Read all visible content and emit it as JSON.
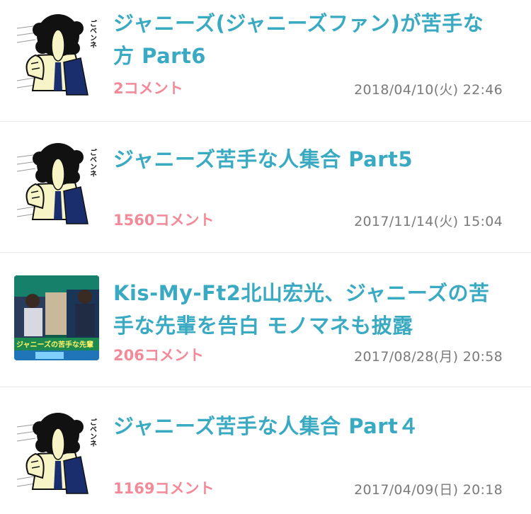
{
  "articles": [
    {
      "title": "ジャニーズ(ジャニーズファン)が苦手な方 Part6",
      "comments": "2コメント",
      "date": "2018/04/10(火) 22:46",
      "thumb_text": "ごベンネ"
    },
    {
      "title": "ジャニーズ苦手な人集合 Part5",
      "comments": "1560コメント",
      "date": "2017/11/14(火) 15:04",
      "thumb_text": "ごベンネ"
    },
    {
      "title": "Kis-My-Ft2北山宏光、ジャニーズの苦手な先輩を告白 モノマネも披露",
      "comments": "206コメント",
      "date": "2017/08/28(月) 20:58",
      "thumb_text": "ジャニーズの苦手な先輩"
    },
    {
      "title": "ジャニーズ苦手な人集合 Part４",
      "comments": "1169コメント",
      "date": "2017/04/09(日) 20:18",
      "thumb_text": "ごベンネ"
    }
  ],
  "colors": {
    "title": "#3aa9c2",
    "comments": "#f28a99",
    "date": "#7a7a7a",
    "divider": "#e8e8e8"
  }
}
